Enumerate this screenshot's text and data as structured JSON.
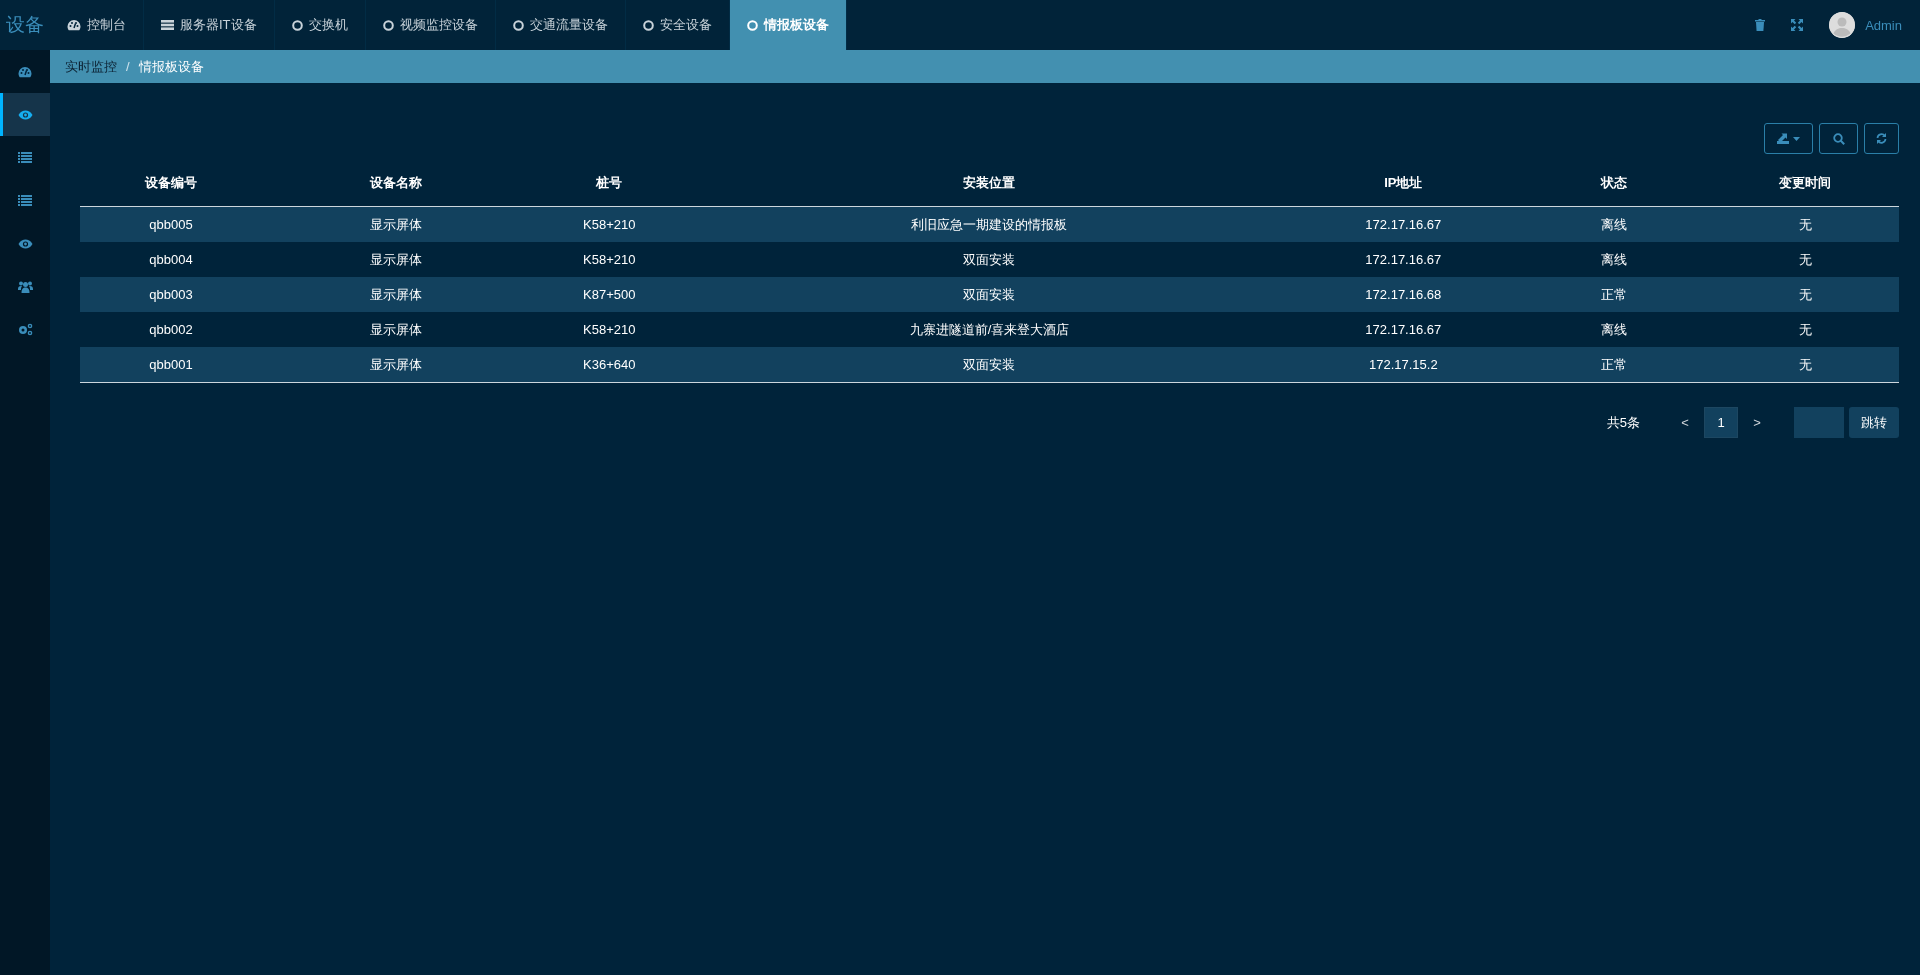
{
  "logo": "设备",
  "tabs": [
    {
      "label": "控制台",
      "kind": "gauge",
      "selected": false
    },
    {
      "label": "服务器IT设备",
      "kind": "server",
      "selected": false
    },
    {
      "label": "交换机",
      "kind": "circle",
      "selected": false
    },
    {
      "label": "视频监控设备",
      "kind": "circle",
      "selected": false
    },
    {
      "label": "交通流量设备",
      "kind": "circle",
      "selected": false
    },
    {
      "label": "安全设备",
      "kind": "circle",
      "selected": false
    },
    {
      "label": "情报板设备",
      "kind": "circle",
      "selected": true
    }
  ],
  "user": {
    "name": "Admin"
  },
  "sidebar": {
    "items": [
      {
        "kind": "gauge",
        "selected": false
      },
      {
        "kind": "eye",
        "selected": true
      },
      {
        "kind": "list",
        "selected": false
      },
      {
        "kind": "list",
        "selected": false
      },
      {
        "kind": "eye",
        "selected": false
      },
      {
        "kind": "users",
        "selected": false
      },
      {
        "kind": "gears",
        "selected": false
      }
    ]
  },
  "breadcrumb": {
    "items": [
      "实时监控",
      "情报板设备"
    ],
    "separator": "/"
  },
  "table": {
    "columns": [
      "设备编号",
      "设备名称",
      "桩号",
      "安装位置",
      "IP地址",
      "状态",
      "变更时间"
    ],
    "rows": [
      [
        "qbb005",
        "显示屏体",
        "K58+210",
        "利旧应急一期建设的情报板",
        "172.17.16.67",
        "离线",
        "无"
      ],
      [
        "qbb004",
        "显示屏体",
        "K58+210",
        "双面安装",
        "172.17.16.67",
        "离线",
        "无"
      ],
      [
        "qbb003",
        "显示屏体",
        "K87+500",
        "双面安装",
        "172.17.16.68",
        "正常",
        "无"
      ],
      [
        "qbb002",
        "显示屏体",
        "K58+210",
        "九寨进隧道前/喜来登大酒店",
        "172.17.16.67",
        "离线",
        "无"
      ],
      [
        "qbb001",
        "显示屏体",
        "K36+640",
        "双面安装",
        "172.17.15.2",
        "正常",
        "无"
      ]
    ]
  },
  "pagination": {
    "total": "共5条",
    "prev": "<",
    "pages": [
      {
        "label": "1",
        "selected": true
      }
    ],
    "next": ">",
    "jump": "跳转"
  }
}
